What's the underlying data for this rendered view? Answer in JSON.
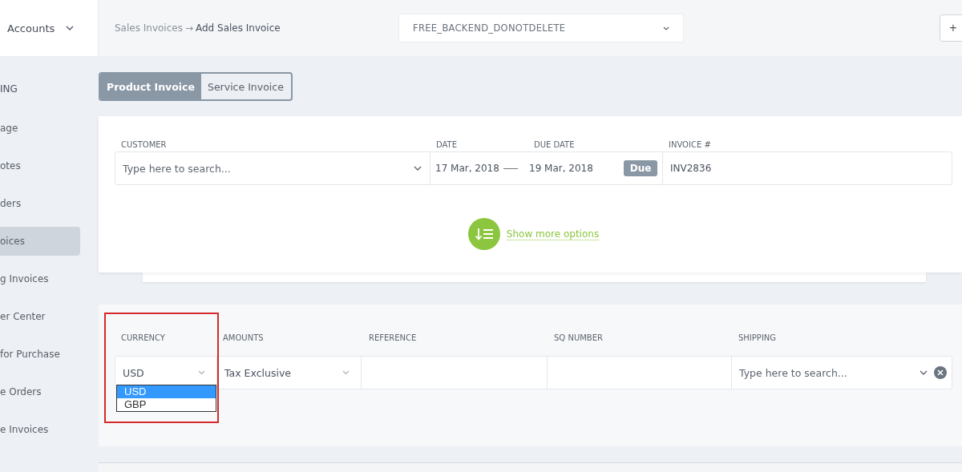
{
  "header": {
    "account_menu": "Accounts",
    "breadcrumb": {
      "parent": "Sales Invoices",
      "arrow": "→",
      "current": "Add Sales Invoice"
    },
    "company_select": "FREE_BACKEND_DONOTDELETE",
    "add_button": "+"
  },
  "sidebar": {
    "section": "ING",
    "items": [
      {
        "label": "age",
        "selected": false
      },
      {
        "label": "otes",
        "selected": false
      },
      {
        "label": "ders",
        "selected": false
      },
      {
        "label": "oices",
        "selected": true
      },
      {
        "label": "g Invoices",
        "selected": false
      },
      {
        "label": "er Center",
        "selected": false
      },
      {
        "label": " for Purchase",
        "selected": false
      },
      {
        "label": "e Orders",
        "selected": false
      },
      {
        "label": "e Invoices",
        "selected": false
      }
    ]
  },
  "tabs": [
    {
      "label": "Product Invoice",
      "selected": true
    },
    {
      "label": "Service Invoice",
      "selected": false
    }
  ],
  "invoice": {
    "customer": {
      "label": "CUSTOMER",
      "placeholder": "Type here to search..."
    },
    "date": {
      "label": "DATE",
      "value": "17 Mar, 2018"
    },
    "due_date": {
      "label": "DUE DATE",
      "value": "19 Mar, 2018"
    },
    "due_badge": "Due",
    "invoice_number": {
      "label": "INVOICE #",
      "value": "INV2836"
    },
    "more_options": "Show more options"
  },
  "details": {
    "currency": {
      "label": "CURRENCY",
      "value": "USD",
      "expanded": true,
      "options": [
        {
          "label": "USD",
          "selected": true
        },
        {
          "label": "GBP",
          "selected": false
        }
      ]
    },
    "amounts": {
      "label": "AMOUNTS",
      "value": "Tax Exclusive"
    },
    "reference": {
      "label": "REFERENCE"
    },
    "sq_number": {
      "label": "SQ NUMBER"
    },
    "shipping": {
      "label": "SHIPPING",
      "placeholder": "Type here to search..."
    }
  }
}
